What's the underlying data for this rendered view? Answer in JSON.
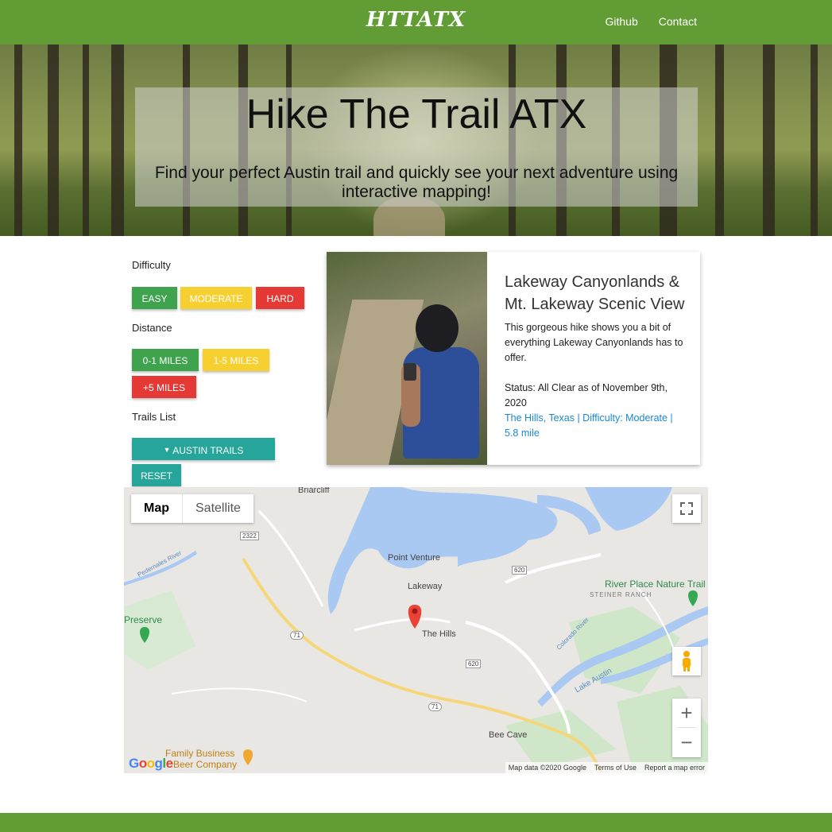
{
  "navbar": {
    "brand": "HTTATX",
    "links": [
      "Github",
      "Contact"
    ]
  },
  "hero": {
    "title": "Hike The Trail ATX",
    "subtitle": "Find your perfect Austin trail and quickly see your next adventure using interactive mapping!"
  },
  "filters": {
    "difficulty_label": "Difficulty",
    "difficulty_buttons": [
      "Easy",
      "Moderate",
      "Hard"
    ],
    "distance_label": "Distance",
    "distance_buttons": [
      "0-1 Miles",
      "1-5 Miles",
      "+5 Miles"
    ],
    "trails_label": "Trails List",
    "trails_dropdown": "Austin Trails",
    "reset_button": "Reset"
  },
  "card": {
    "title": "Lakeway Canyonlands & Mt. Lakeway Scenic View",
    "description": "This gorgeous hike shows you a bit of everything Lakeway Canyonlands has to offer.",
    "status": "Status: All Clear as of November 9th, 2020",
    "link": "The Hills, Texas | Difficulty: Moderate | 5.8 mile"
  },
  "map": {
    "type_buttons": [
      "Map",
      "Satellite"
    ],
    "zoom_in": "+",
    "zoom_out": "−",
    "places": {
      "briarcliff": "Briarcliff",
      "point_venture": "Point Venture",
      "lakeway": "Lakeway",
      "the_hills": "The Hills",
      "bee_cave": "Bee Cave",
      "preserve": "Preserve",
      "river_place": "River Place Nature Trail",
      "steiner_ranch": "STEINER RANCH",
      "family_business": "Family Business",
      "beer_company": "Beer Company",
      "pedernales": "Pedernales River",
      "colorado": "Colorado River",
      "lake_austin": "Lake Austin",
      "r2322": "2322",
      "r620a": "620",
      "r620b": "620",
      "r71a": "71",
      "r71b": "71"
    },
    "google": "Google",
    "footer": [
      "Map data ©2020 Google",
      "Terms of Use",
      "Report a map error"
    ]
  },
  "colors": {
    "brand_green": "#629c35",
    "easy_green": "#3fa34d",
    "moderate_yellow": "#f6cf31",
    "hard_red": "#e53935",
    "teal": "#26a69a",
    "link_blue": "#1a88d6"
  }
}
